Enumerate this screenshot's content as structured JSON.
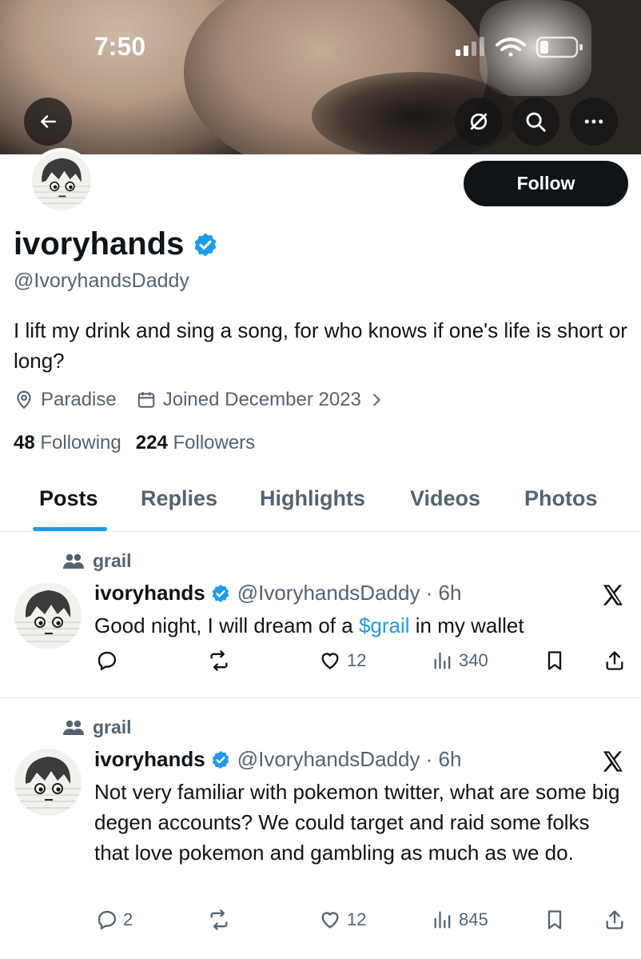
{
  "status_bar": {
    "time": "7:50"
  },
  "header": {
    "back_icon": "arrow-left-icon",
    "grok_icon": "slash-circle-icon",
    "search_icon": "search-icon",
    "more_icon": "more-horizontal-icon"
  },
  "profile": {
    "follow_label": "Follow",
    "display_name": "ivoryhands",
    "handle": "@IvoryhandsDaddy",
    "bio": "I lift my drink and sing a song, for who knows if one's life is short or long?",
    "location": "Paradise",
    "joined": "Joined December 2023",
    "following_count": "48",
    "following_label": "Following",
    "followers_count": "224",
    "followers_label": "Followers",
    "verified_color": "#1d9bf0"
  },
  "tabs": [
    {
      "label": "Posts",
      "active": true
    },
    {
      "label": "Replies",
      "active": false
    },
    {
      "label": "Highlights",
      "active": false
    },
    {
      "label": "Videos",
      "active": false
    },
    {
      "label": "Photos",
      "active": false
    }
  ],
  "posts": [
    {
      "community": "grail",
      "name": "ivoryhands",
      "handle_time": "@IvoryhandsDaddy · 6h",
      "text_before": "Good night, I will dream of a ",
      "cashtag": "$grail",
      "text_after": " in my wallet",
      "replies": "",
      "likes": "12",
      "views": "340"
    },
    {
      "community": "grail",
      "name": "ivoryhands",
      "handle_time": "@IvoryhandsDaddy · 6h",
      "text": "Not very familiar with pokemon twitter, what are some big degen accounts? We could target and raid some folks that love pokemon and gambling as much as we do.",
      "replies": "2",
      "likes": "12",
      "views": "845"
    }
  ]
}
